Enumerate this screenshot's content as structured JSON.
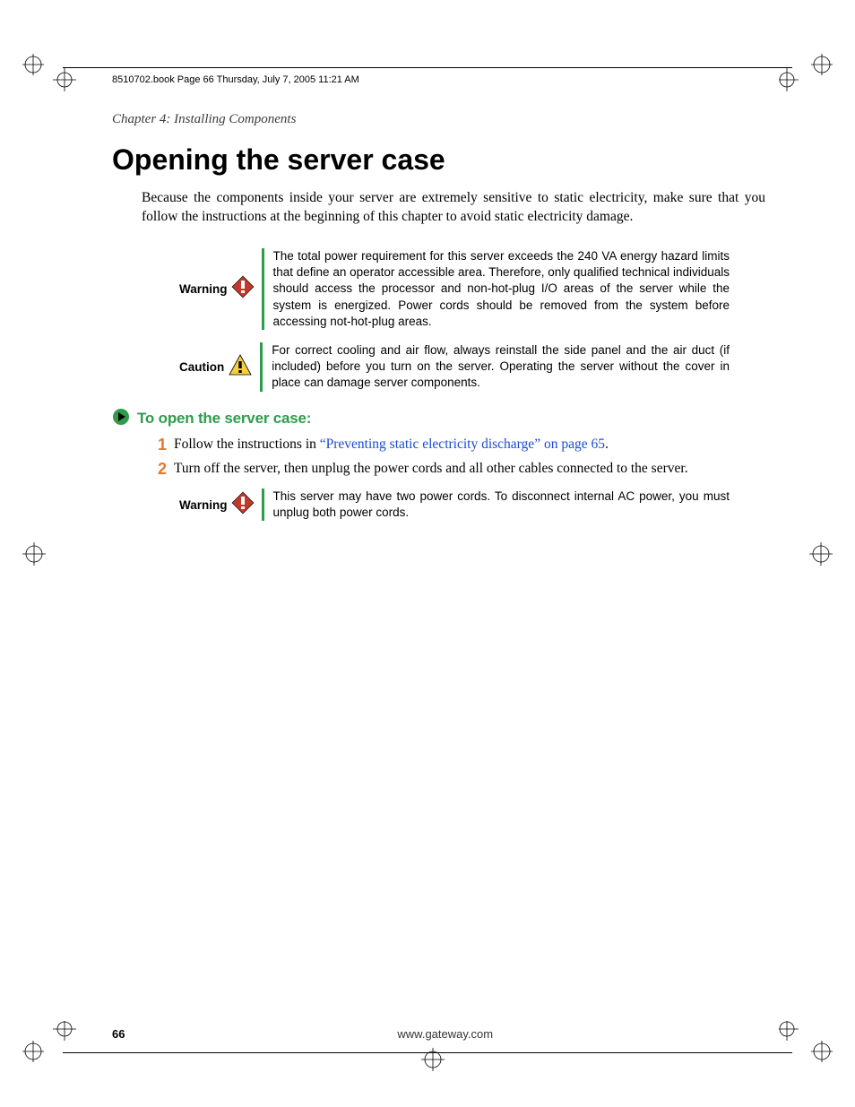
{
  "book_header": "8510702.book  Page 66  Thursday, July 7, 2005  11:21 AM",
  "chapter": "Chapter 4: Installing Components",
  "heading": "Opening the server case",
  "intro": "Because the components inside your server are extremely sensitive to static electricity, make sure that you follow the instructions at the beginning of this chapter to avoid static electricity damage.",
  "callouts": {
    "warning1": {
      "label": "Warning",
      "text": "The total power requirement for this server exceeds the 240 VA energy hazard limits that define an operator accessible area. Therefore, only qualified technical individuals should access the processor and non-hot-plug I/O areas of the server while the system is energized. Power cords should be removed from the system before accessing not-hot-plug areas."
    },
    "caution": {
      "label": "Caution",
      "text": "For correct cooling and air flow, always reinstall the side panel and the air duct (if included) before you turn on the server. Operating the server without the cover in place can damage server components."
    },
    "warning2": {
      "label": "Warning",
      "text": "This server may have two power cords. To disconnect internal AC power, you must unplug both power cords."
    }
  },
  "steps_title": "To open the server case:",
  "steps": [
    {
      "num": "1",
      "pre": "Follow the instructions in ",
      "xref": "“Preventing static electricity discharge” on page 65",
      "post": "."
    },
    {
      "num": "2",
      "pre": "Turn off the server, then unplug the power cords and all other cables connected to the server.",
      "xref": "",
      "post": ""
    }
  ],
  "footer": {
    "page_num": "66",
    "url": "www.gateway.com"
  }
}
